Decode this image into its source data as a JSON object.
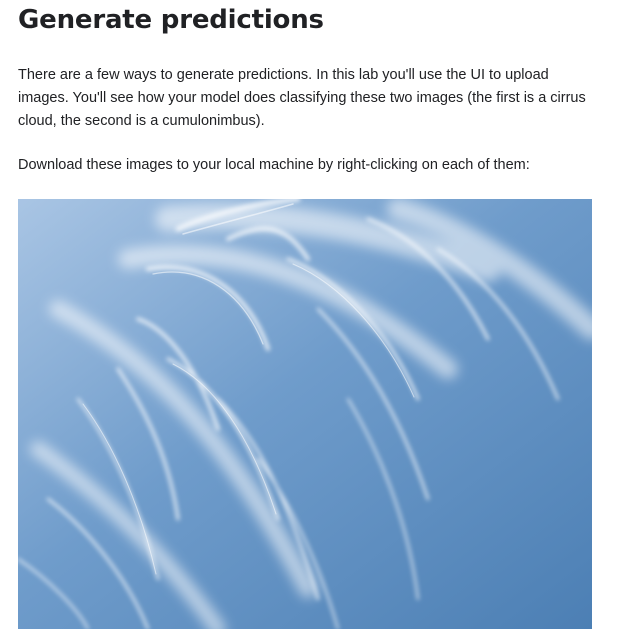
{
  "section": {
    "heading": "Generate predictions",
    "paragraphs": [
      "There are a few ways to generate predictions. In this lab you'll use the UI to upload images. You'll see how your model does classifying these two images (the first is a cirrus cloud, the second is a cumulonimbus).",
      "Download these images to your local machine by right-clicking on each of them:"
    ]
  },
  "image": {
    "subject": "cirrus cloud photo",
    "colors": {
      "sky_light": "#a9c5e4",
      "sky_mid": "#6f9ccb",
      "sky_dark": "#4c7fb4",
      "cloud": "#ffffff"
    }
  }
}
